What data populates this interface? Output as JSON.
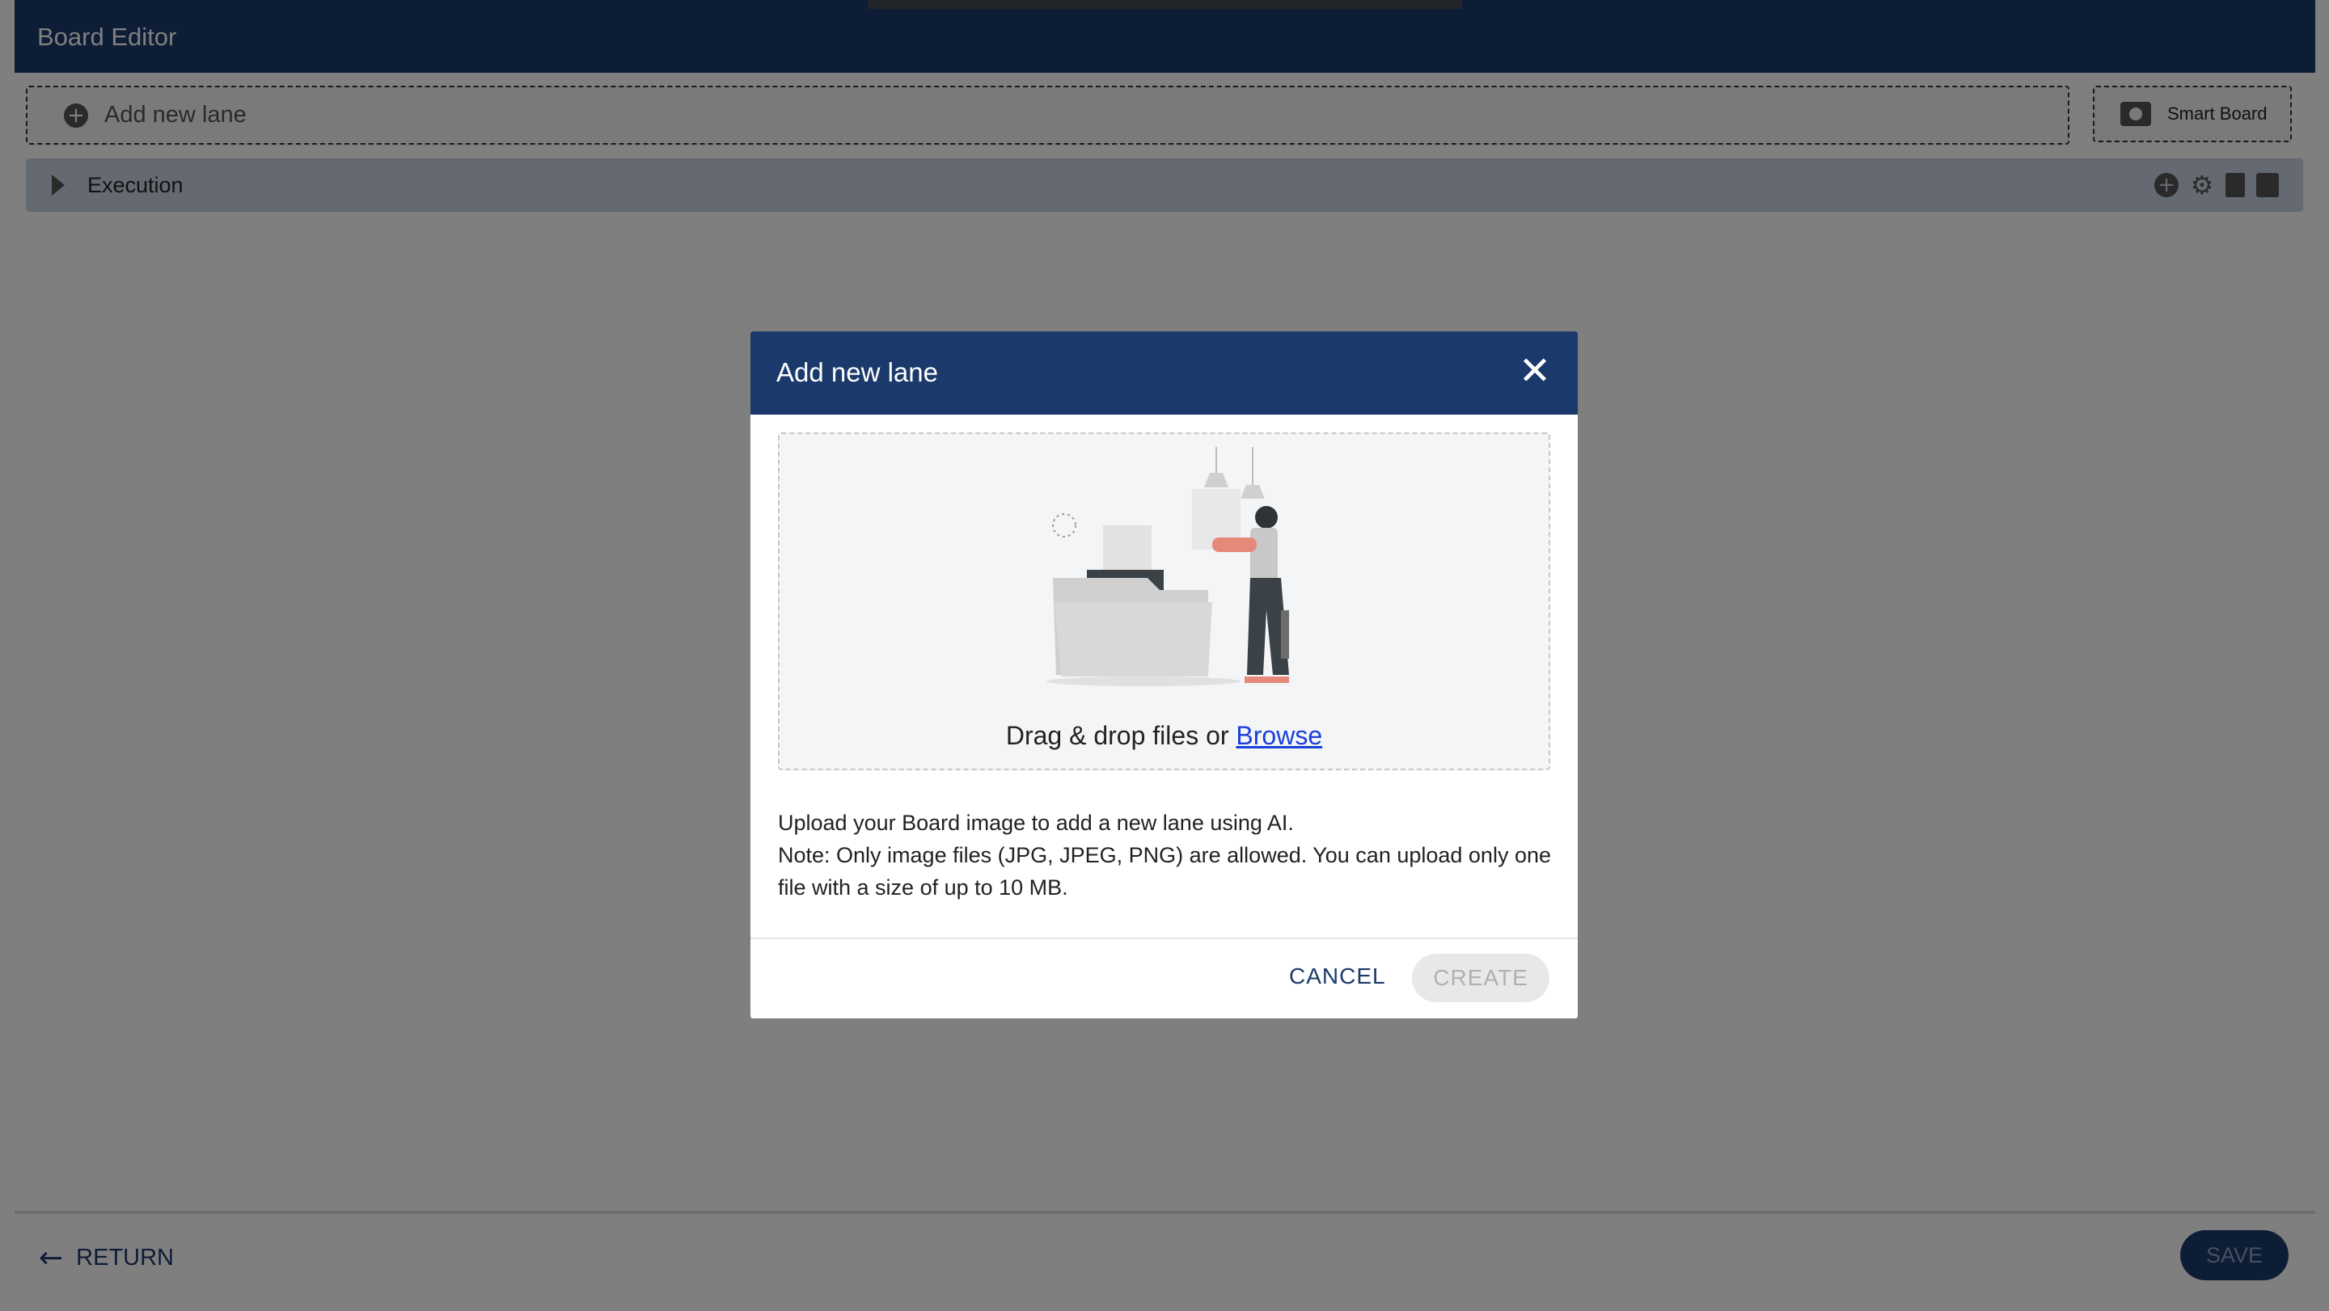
{
  "app": {
    "title": "Board Editor",
    "add_lane_label": "Add new lane",
    "smart_board_label": "Smart Board",
    "lane_name": "Execution"
  },
  "footer": {
    "return_label": "RETURN",
    "save_label": "SAVE"
  },
  "modal": {
    "title": "Add new lane",
    "dropzone_text": "Drag & drop files or",
    "browse_link": "Browse",
    "description_line1": "Upload your Board image to add a new lane using AI.",
    "description_line2": "Note: Only image files (JPG, JPEG, PNG) are allowed. You can upload only one file with a size of up to 10 MB.",
    "cancel_label": "CANCEL",
    "create_label": "CREATE"
  },
  "icons": {
    "close": "close-icon",
    "add_circle": "add-circle-icon",
    "camera": "camera-icon",
    "expand": "chevron-right-icon",
    "settings": "gear-icon",
    "delete": "trash-icon",
    "copy": "copy-icon",
    "back": "arrow-left-icon"
  },
  "colors": {
    "header": "#1b3a6b",
    "link": "#1a3fd9",
    "lane": "#c9d3e4"
  }
}
